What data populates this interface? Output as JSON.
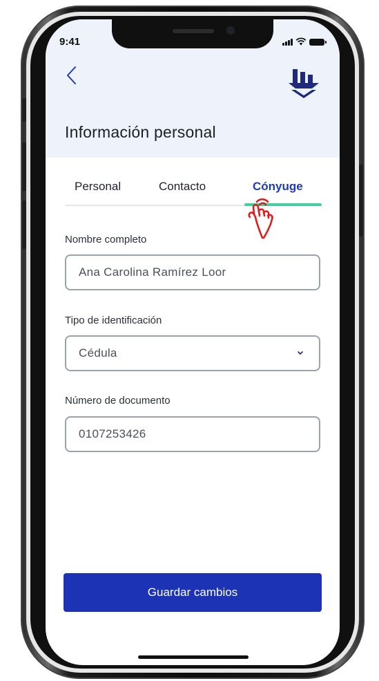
{
  "status_bar": {
    "time": "9:41"
  },
  "header": {
    "title": "Información personal"
  },
  "tabs": [
    {
      "label": "Personal",
      "active": false
    },
    {
      "label": "Contacto",
      "active": false
    },
    {
      "label": "Cónyuge",
      "active": true
    }
  ],
  "form": {
    "full_name": {
      "label": "Nombre completo",
      "value": "Ana Carolina Ramírez Loor"
    },
    "id_type": {
      "label": "Tipo de identificación",
      "value": "Cédula"
    },
    "document_number": {
      "label": "Número de documento",
      "value": "0107253426"
    }
  },
  "actions": {
    "save_label": "Guardar cambios"
  },
  "icons": {
    "back": "chevron-left-icon",
    "logo": "brand-logo",
    "dropdown": "chevron-down-icon",
    "tap_hint": "tap-hand-icon"
  },
  "colors": {
    "primary": "#1c33b5",
    "tab_active": "#1f3bb3",
    "tab_indicator": "#3fcfa0",
    "header_bg": "#eef2fb",
    "hand_hint": "#e01b1b"
  }
}
